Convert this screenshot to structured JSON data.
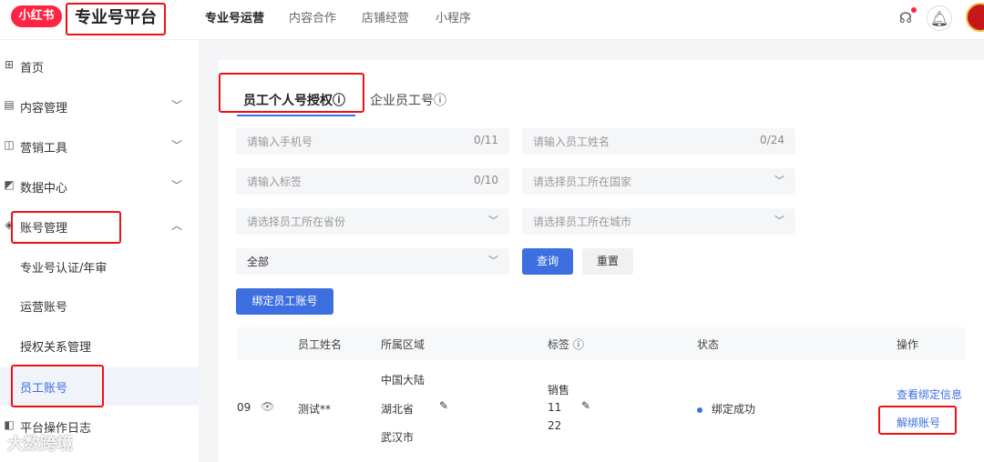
{
  "header": {
    "logo_text": "小红书",
    "brand": "专业号平台",
    "nav": [
      "专业号运营",
      "内容合作",
      "店铺经营",
      "小程序"
    ]
  },
  "sidebar": {
    "items": [
      {
        "label": "首页"
      },
      {
        "label": "内容管理"
      },
      {
        "label": "营销工具"
      },
      {
        "label": "数据中心"
      },
      {
        "label": "账号管理"
      },
      {
        "label": "专业号认证/年审"
      },
      {
        "label": "运营账号"
      },
      {
        "label": "授权关系管理"
      },
      {
        "label": "员工账号"
      },
      {
        "label": "平台操作日志"
      }
    ]
  },
  "tabs": [
    "员工个人号授权ⓘ",
    "企业员工号ⓘ"
  ],
  "filters": {
    "phone": {
      "placeholder": "请输入手机号",
      "count": "0/11"
    },
    "name": {
      "placeholder": "请输入员工姓名",
      "count": "0/24"
    },
    "tag": {
      "placeholder": "请输入标签",
      "count": "0/10"
    },
    "country": {
      "placeholder": "请选择员工所在国家"
    },
    "province": {
      "placeholder": "请选择员工所在省份"
    },
    "city": {
      "placeholder": "请选择员工所在城市"
    },
    "status": {
      "value": "全部"
    },
    "query_label": "查询",
    "reset_label": "重置"
  },
  "bind_button": "绑定员工账号",
  "table": {
    "headers": [
      "员工姓名",
      "所属区域",
      "标签 ⓘ",
      "状态",
      "操作"
    ],
    "row": {
      "id_suffix": "09",
      "name": "测试**",
      "region": [
        "中国大陆",
        "湖北省",
        "武汉市"
      ],
      "tags": [
        "销售",
        "11",
        "22"
      ],
      "status": "绑定成功",
      "action_view": "查看绑定信息",
      "action_unbind": "解绑账号"
    }
  },
  "watermark": "大数跨境",
  "colors": {
    "brand_red": "#ff2442",
    "accent_blue": "#3d6fe0",
    "annotation_red": "#ee1111"
  }
}
